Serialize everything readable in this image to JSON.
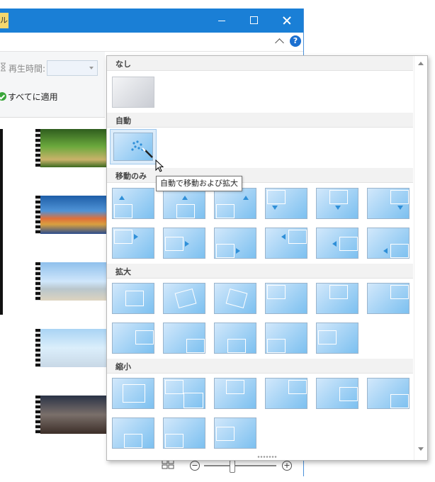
{
  "window": {
    "title_tab_fragment": "ル",
    "help_label": "?"
  },
  "ribbon": {
    "duration_label": "再生時間:",
    "duration_value": "",
    "apply_all_label": "すべてに適用"
  },
  "panel": {
    "sections": {
      "none": "なし",
      "auto": "自動",
      "pan_only": "移動のみ",
      "zoom_in": "拡大",
      "zoom_out": "縮小"
    },
    "tooltip": "自動で移動および拡大"
  },
  "statusbar": {
    "zoom_out_label": "−",
    "zoom_in_label": "+"
  },
  "colors": {
    "titlebar": "#1a7fd6",
    "tile_border": "#9ab4cc",
    "arrow": "#2f8fd8"
  }
}
